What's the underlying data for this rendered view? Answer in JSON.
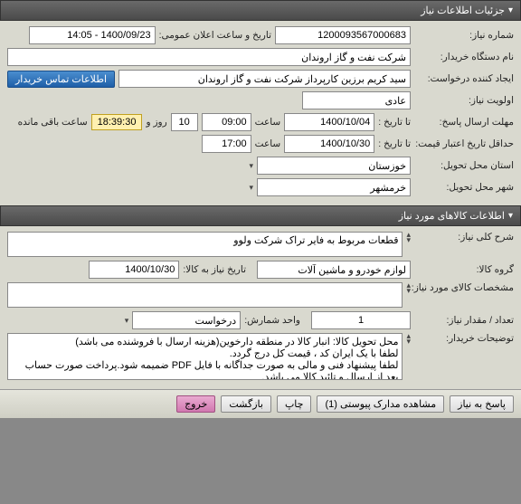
{
  "sections": {
    "need_info_title": "جزئیات اطلاعات نیاز",
    "need_items_title": "اطلاعات کالاهای مورد نیاز"
  },
  "fields": {
    "need_no_label": "شماره نیاز:",
    "need_no": "1200093567000683",
    "announce_dt_label": "تاریخ و ساعت اعلان عمومی:",
    "announce_dt": "1400/09/23 - 14:05",
    "buyer_org_label": "نام دستگاه خریدار:",
    "buyer_org": "شرکت نفت و گاز اروندان",
    "requester_label": "ایجاد کننده درخواست:",
    "requester": "سید کریم برزین کارپرداز شرکت نفت و گاز اروندان",
    "buyer_contact_btn": "اطلاعات تماس خریدار",
    "priority_label": "اولویت نیاز:",
    "priority": "عادی",
    "reply_deadline_label": "مهلت ارسال پاسخ:",
    "to_date_label": "تا تاریخ :",
    "reply_to_date": "1400/10/04",
    "time_label": "ساعت",
    "reply_time": "09:00",
    "days_left": "10",
    "days_and_label": "روز و",
    "time_left": "18:39:30",
    "time_left_suffix": "ساعت باقی مانده",
    "price_valid_label": "حداقل تاریخ اعتبار قیمت:",
    "price_valid_date": "1400/10/30",
    "price_valid_time": "17:00",
    "deliver_province_label": "استان محل تحویل:",
    "deliver_province": "خوزستان",
    "deliver_city_label": "شهر محل تحویل:",
    "deliver_city": "خرمشهر",
    "need_desc_label": "شرح کلی نیاز:",
    "need_desc": "قطعات مربوط به فایر تراک شرکت ولوو",
    "goods_group_label": "گروه کالا:",
    "goods_group": "لوازم خودرو و ماشین آلات",
    "need_by_date_label": "تاریخ نیاز به کالا:",
    "need_by_date": "1400/10/30",
    "goods_spec_label": "مشخصات کالای مورد نیاز:",
    "goods_spec": "",
    "qty_label": "تعداد / مقدار نیاز:",
    "qty": "1",
    "unit_label": "واحد شمارش:",
    "unit": "درخواست",
    "buyer_notes_label": "توضیحات خریدار:",
    "buyer_notes": "محل تحویل کالا: انبار کالا در منطقه دارخوین(هزینه ارسال با فروشنده می باشد)\nلطفا با یک ایران کد ، قیمت کل درج گردد.\nلطفا پیشنهاد فنی و مالی به صورت جداگانه با فایل PDF ضمیمه شود.پرداخت صورت حساب بعد از ارسال و تائید کالا می باشد."
  },
  "footer": {
    "reply_btn": "پاسخ به نیاز",
    "attachments_btn": "مشاهده مدارک پیوستی (1)",
    "print_btn": "چاپ",
    "back_btn": "بازگشت",
    "exit_btn": "خروج"
  }
}
